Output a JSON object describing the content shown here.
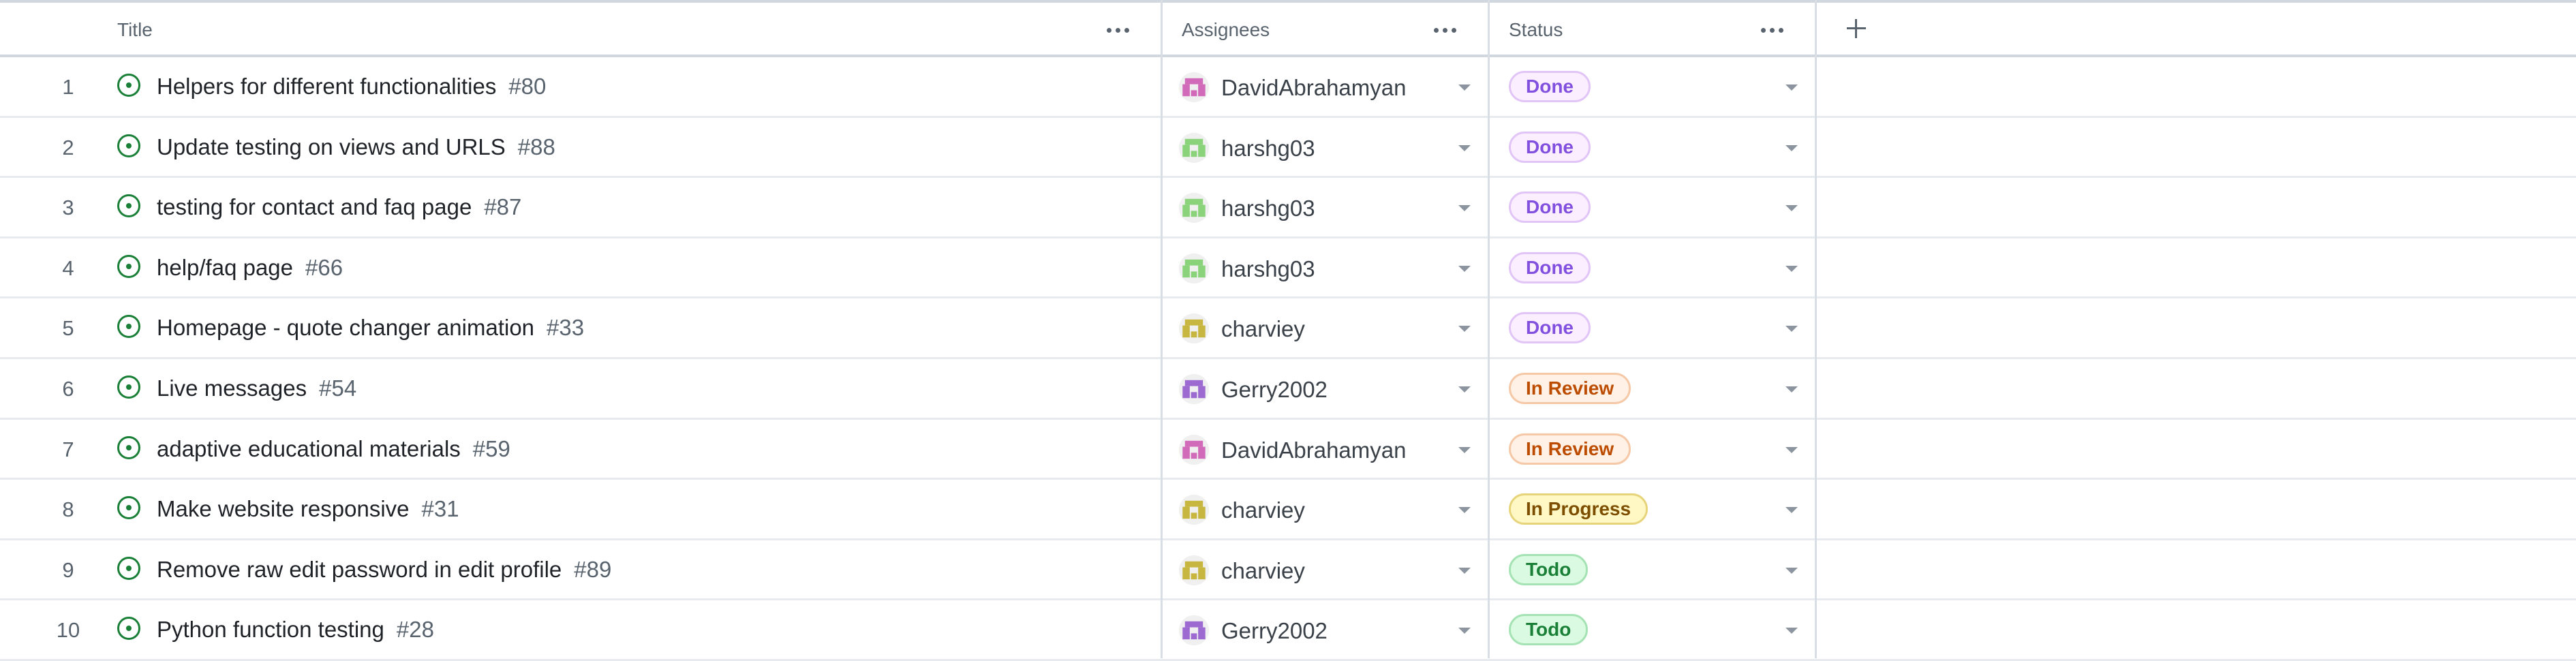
{
  "header": {
    "title_label": "Title",
    "assignees_label": "Assignees",
    "status_label": "Status"
  },
  "status_colors": {
    "Done": {
      "bg": "#fbefff",
      "border": "#e2c5f7",
      "text": "#8250df"
    },
    "In Review": {
      "bg": "#fff1e5",
      "border": "#f5c9a7",
      "text": "#bc4c00"
    },
    "In Progress": {
      "bg": "#fff8c5",
      "border": "#e7d47a",
      "text": "#7d4e00"
    },
    "Todo": {
      "bg": "#dafbe1",
      "border": "#a6e3b4",
      "text": "#1a7f37"
    }
  },
  "avatar_colors": {
    "DavidAbrahamyan": "#d16ab8",
    "harshg03": "#8bd37a",
    "charviey": "#c7b740",
    "Gerry2002": "#9c6ad1"
  },
  "rows": [
    {
      "num": "1",
      "title": "Helpers for different functionalities",
      "issue": "#80",
      "assignee": "DavidAbrahamyan",
      "status": "Done"
    },
    {
      "num": "2",
      "title": "Update testing on views and URLS",
      "issue": "#88",
      "assignee": "harshg03",
      "status": "Done"
    },
    {
      "num": "3",
      "title": "testing for contact and faq page",
      "issue": "#87",
      "assignee": "harshg03",
      "status": "Done"
    },
    {
      "num": "4",
      "title": "help/faq page",
      "issue": "#66",
      "assignee": "harshg03",
      "status": "Done"
    },
    {
      "num": "5",
      "title": "Homepage - quote changer animation",
      "issue": "#33",
      "assignee": "charviey",
      "status": "Done"
    },
    {
      "num": "6",
      "title": "Live messages",
      "issue": "#54",
      "assignee": "Gerry2002",
      "status": "In Review"
    },
    {
      "num": "7",
      "title": "adaptive educational materials",
      "issue": "#59",
      "assignee": "DavidAbrahamyan",
      "status": "In Review"
    },
    {
      "num": "8",
      "title": "Make website responsive",
      "issue": "#31",
      "assignee": "charviey",
      "status": "In Progress"
    },
    {
      "num": "9",
      "title": "Remove raw edit password in edit profile",
      "issue": "#89",
      "assignee": "charviey",
      "status": "Todo"
    },
    {
      "num": "10",
      "title": "Python function testing",
      "issue": "#28",
      "assignee": "Gerry2002",
      "status": "Todo"
    }
  ]
}
